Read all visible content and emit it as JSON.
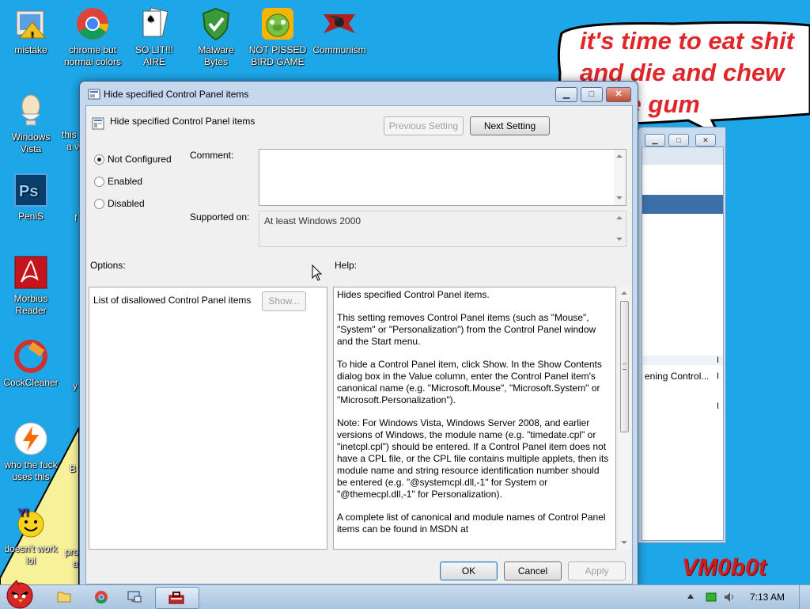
{
  "desktop_icons": [
    {
      "label": "mistake"
    },
    {
      "label": "chrome but normal colors"
    },
    {
      "label": "SO LIT!!! AIRE"
    },
    {
      "label": "Malware Bytes"
    },
    {
      "label": "NOT PISSED BIRD GAME"
    },
    {
      "label": "Communism"
    },
    {
      "label": "Windows Vista"
    },
    {
      "label": "PeniS"
    },
    {
      "label": "Morbius Reader"
    },
    {
      "label": "CockCleaner"
    },
    {
      "label": "who the fuck uses this"
    },
    {
      "label": "doesn't work lol"
    }
  ],
  "partial_icon_labels": [
    "this",
    "a v",
    "f",
    "y",
    "B",
    "pro",
    "a"
  ],
  "meme": {
    "line1": "it's time to eat shit",
    "line2": "and die and chew",
    "line3": "ble gum",
    "watermark": "VM0b0t"
  },
  "background_window": {
    "row_text": "ening Control...",
    "markers": [
      "I",
      "I",
      "I"
    ]
  },
  "dialog": {
    "title": "Hide specified Control Panel items",
    "heading": "Hide specified Control Panel items",
    "prev_label": "Previous Setting",
    "next_label": "Next Setting",
    "radios": {
      "not_configured": "Not Configured",
      "enabled": "Enabled",
      "disabled": "Disabled",
      "selected": "Not Configured"
    },
    "comment_label": "Comment:",
    "comment_value": "",
    "supported_label": "Supported on:",
    "supported_value": "At least Windows 2000",
    "options_label": "Options:",
    "help_label": "Help:",
    "option_item": "List of disallowed Control Panel items",
    "show_label": "Show...",
    "help_paragraphs": [
      "Hides specified Control Panel items.",
      "This setting removes Control Panel items (such as \"Mouse\", \"System\" or \"Personalization\") from the Control Panel window and the Start menu.",
      "To hide a Control Panel item, click Show. In the Show Contents dialog box in the Value column, enter the Control Panel item's canonical name (e.g. \"Microsoft.Mouse\", \"Microsoft.System\" or \"Microsoft.Personalization\").",
      "Note: For Windows Vista, Windows Server 2008, and earlier versions of Windows, the module name (e.g. \"timedate.cpl\" or \"inetcpl.cpl\") should be entered. If a Control Panel item does not have a CPL file, or the CPL file contains multiple applets, then its module name and string resource identification number should be entered (e.g. \"@systemcpl.dll,-1\" for System or \"@themecpl.dll,-1\" for Personalization).",
      "A complete list of canonical and module names of Control Panel items can be found in MSDN at"
    ],
    "ok_label": "OK",
    "cancel_label": "Cancel",
    "apply_label": "Apply"
  },
  "taskbar": {
    "clock": "7:13 AM"
  },
  "colors": {
    "desktop": "#1ea7e8",
    "meme_red": "#e0262a",
    "dialog_frame": "#c5d8ee"
  }
}
